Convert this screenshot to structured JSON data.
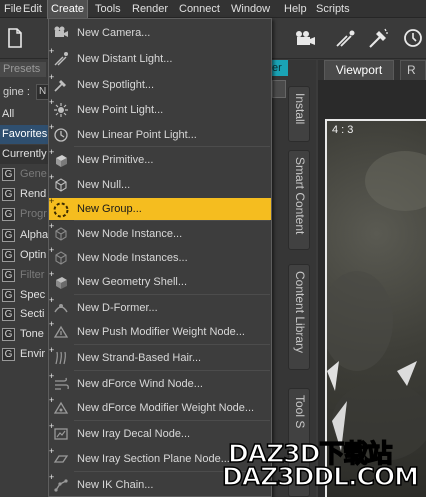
{
  "menubar": {
    "items": [
      "File",
      "Edit",
      "Create",
      "Tools",
      "Render",
      "Connect",
      "Window",
      "Help",
      "Scripts"
    ],
    "active": "Create"
  },
  "left_panel": {
    "tab_label": "Presets",
    "engine_label": "gine :",
    "engine_value": "N",
    "rows": [
      "All",
      "Favorites",
      "Currently"
    ],
    "items": [
      {
        "icon": "G",
        "label": "Gene",
        "dim": true
      },
      {
        "icon": "G",
        "label": "Rend",
        "dim": false
      },
      {
        "icon": "G",
        "label": "Progr",
        "dim": true
      },
      {
        "icon": "G",
        "label": "Alpha",
        "dim": false
      },
      {
        "icon": "G",
        "label": "Optin",
        "dim": false
      },
      {
        "icon": "G",
        "label": "Filter",
        "dim": true
      },
      {
        "icon": "G",
        "label": "Spec",
        "dim": false
      },
      {
        "icon": "G",
        "label": "Secti",
        "dim": false
      },
      {
        "icon": "G",
        "label": "Tone",
        "dim": false
      },
      {
        "icon": "G",
        "label": "Envir",
        "dim": false
      }
    ]
  },
  "side_tabs": {
    "cyan_tab_label": "er",
    "tabs": [
      "Install",
      "Smart Content",
      "Content Library",
      "Tool S"
    ]
  },
  "viewport": {
    "tab_label": "Viewport",
    "tab2_label": "R",
    "aspect_label": "4 : 3"
  },
  "create_menu": {
    "items": [
      {
        "label": "New Camera...",
        "icon": "camera-icon",
        "highlighted": false
      },
      {
        "label": "New Distant Light...",
        "icon": "distant-light-icon",
        "highlighted": false
      },
      {
        "label": "New Spotlight...",
        "icon": "spotlight-icon",
        "highlighted": false
      },
      {
        "label": "New Point Light...",
        "icon": "point-light-icon",
        "highlighted": false
      },
      {
        "label": "New Linear Point Light...",
        "icon": "linear-point-light-icon",
        "highlighted": false
      },
      {
        "label": "New Primitive...",
        "icon": "primitive-icon",
        "highlighted": false
      },
      {
        "label": "New Null...",
        "icon": "null-icon",
        "highlighted": false
      },
      {
        "label": "New Group...",
        "icon": "group-icon",
        "highlighted": true
      },
      {
        "label": "New Node Instance...",
        "icon": "node-instance-icon",
        "highlighted": false
      },
      {
        "label": "New Node Instances...",
        "icon": "node-instances-icon",
        "highlighted": false
      },
      {
        "label": "New Geometry Shell...",
        "icon": "geometry-shell-icon",
        "highlighted": false
      },
      {
        "label": "New D-Former...",
        "icon": "dformer-icon",
        "highlighted": false
      },
      {
        "label": "New Push Modifier Weight Node...",
        "icon": "push-modifier-icon",
        "highlighted": false
      },
      {
        "label": "New Strand-Based Hair...",
        "icon": "hair-icon",
        "highlighted": false
      },
      {
        "label": "New dForce Wind Node...",
        "icon": "wind-icon",
        "highlighted": false
      },
      {
        "label": "New dForce Modifier Weight Node...",
        "icon": "dforce-weight-icon",
        "highlighted": false
      },
      {
        "label": "New Iray Decal Node...",
        "icon": "decal-icon",
        "highlighted": false
      },
      {
        "label": "New Iray Section Plane Node...",
        "icon": "section-plane-icon",
        "highlighted": false
      },
      {
        "label": "New IK Chain...",
        "icon": "ik-chain-icon",
        "highlighted": false
      }
    ]
  },
  "watermark": {
    "line1": "DAZ3D下载站",
    "line2": "DAZ3DDL.COM"
  },
  "colors": {
    "highlight": "#f5bd1f",
    "cyan_tab": "#1aa3b5",
    "selected_row": "#2f4f6f"
  }
}
